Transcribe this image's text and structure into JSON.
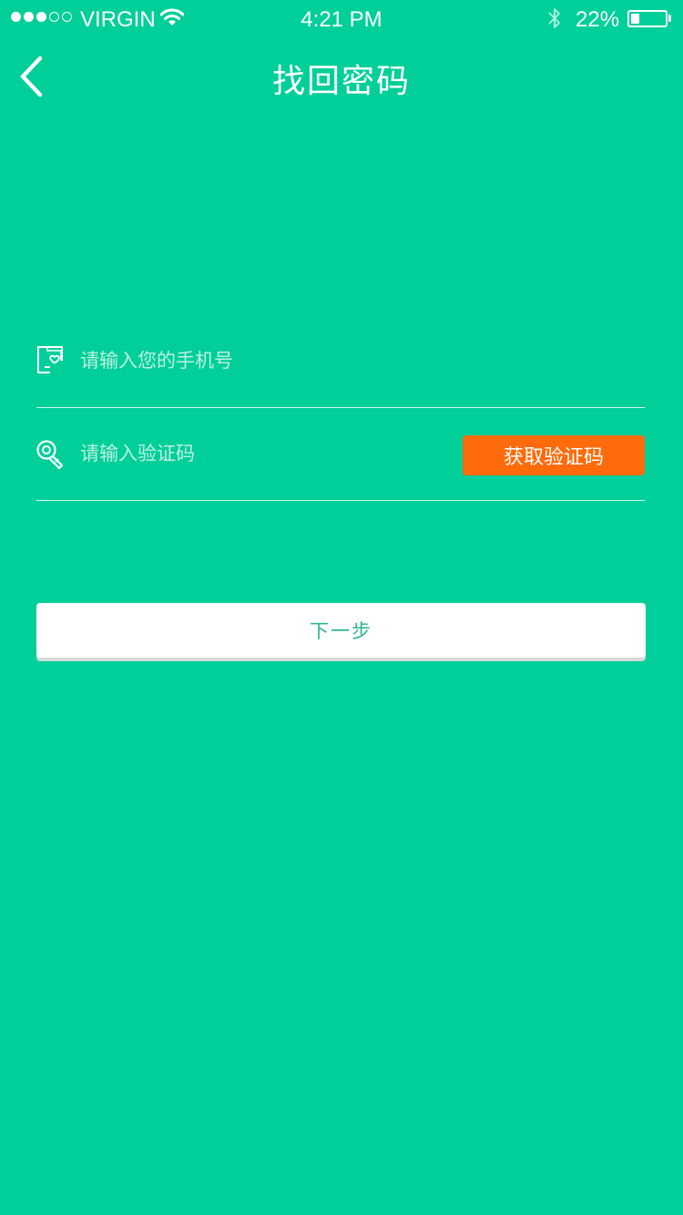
{
  "status_bar": {
    "carrier": "VIRGIN",
    "time": "4:21 PM",
    "battery_percent": "22%",
    "battery_level": 0.22,
    "signal_strength": 3,
    "signal_total": 5
  },
  "nav": {
    "title": "找回密码",
    "back_icon": "chevron-left-icon"
  },
  "form": {
    "phone": {
      "placeholder": "请输入您的手机号",
      "value": "",
      "icon": "phone-icon"
    },
    "code": {
      "placeholder": "请输入验证码",
      "value": "",
      "icon": "key-icon",
      "button_label": "获取验证码"
    },
    "next_label": "下一步"
  },
  "colors": {
    "background": "#00CF9A",
    "accent_orange": "#FF6A0A",
    "next_text": "#2FB491",
    "placeholder": "#BFF0E3"
  }
}
